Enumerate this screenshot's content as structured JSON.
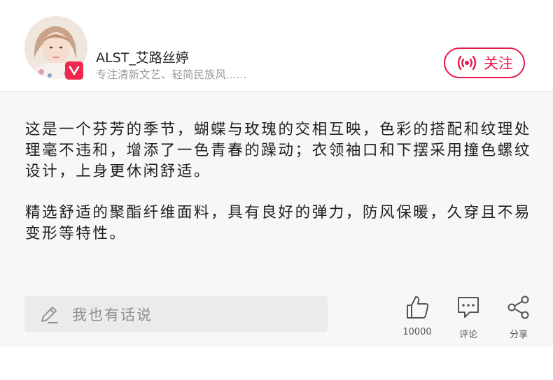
{
  "author": {
    "name": "ALST_艾路丝婷",
    "tagline": "专注清新文艺、轻简民族风......",
    "avatar_icon": "user-avatar",
    "verified_icon": "v-badge-icon"
  },
  "follow": {
    "label": "关注",
    "icon": "live-broadcast-icon",
    "color": "#e8194a"
  },
  "post": {
    "paragraphs": [
      "这是一个芬芳的季节，蝴蝶与玫瑰的交相互映，色彩的搭配和纹理处理毫不违和，增添了一色青春的躁动；衣领袖口和下摆采用撞色螺纹设计，上身更休闲舒适。",
      "精选舒适的聚酯纤维面料，具有良好的弹力，防风保暖，久穿且不易变形等特性。"
    ]
  },
  "comment": {
    "placeholder": "我也有话说",
    "icon": "pencil-icon"
  },
  "actions": {
    "like": {
      "icon": "thumbs-up-icon",
      "label": "10000"
    },
    "comment": {
      "icon": "comment-bubble-icon",
      "label": "评论"
    },
    "share": {
      "icon": "share-icon",
      "label": "分享"
    }
  }
}
